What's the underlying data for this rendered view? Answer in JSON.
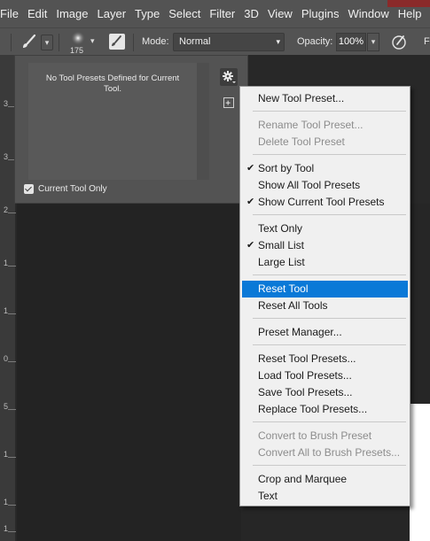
{
  "menubar": {
    "items": [
      "File",
      "Edit",
      "Image",
      "Layer",
      "Type",
      "Select",
      "Filter",
      "3D",
      "View",
      "Plugins",
      "Window",
      "Help"
    ]
  },
  "options_bar": {
    "brush_size": "175",
    "mode_label": "Mode:",
    "mode_value": "Normal",
    "opacity_label": "Opacity:",
    "opacity_value": "100%",
    "trailing_text": "Fl"
  },
  "tool_presets_panel": {
    "empty_message": "No Tool Presets Defined for Current Tool.",
    "current_tool_only_label": "Current Tool Only",
    "current_tool_only_checked": true
  },
  "ruler": {
    "labels": [
      "3",
      "3",
      "2",
      "1",
      "1",
      "0",
      "5",
      "1",
      "1",
      "1"
    ]
  },
  "flyout_menu": {
    "items": [
      {
        "label": "New Tool Preset...",
        "enabled": true,
        "checked": false
      },
      {
        "label": "Rename Tool Preset...",
        "enabled": false,
        "checked": false
      },
      {
        "label": "Delete Tool Preset",
        "enabled": false,
        "checked": false
      },
      {
        "label": "Sort by Tool",
        "enabled": true,
        "checked": true
      },
      {
        "label": "Show All Tool Presets",
        "enabled": true,
        "checked": false
      },
      {
        "label": "Show Current Tool Presets",
        "enabled": true,
        "checked": true
      },
      {
        "label": "Text Only",
        "enabled": true,
        "checked": false
      },
      {
        "label": "Small List",
        "enabled": true,
        "checked": true
      },
      {
        "label": "Large List",
        "enabled": true,
        "checked": false
      },
      {
        "label": "Reset Tool",
        "enabled": true,
        "checked": false,
        "highlighted": true
      },
      {
        "label": "Reset All Tools",
        "enabled": true,
        "checked": false
      },
      {
        "label": "Preset Manager...",
        "enabled": true,
        "checked": false
      },
      {
        "label": "Reset Tool Presets...",
        "enabled": true,
        "checked": false
      },
      {
        "label": "Load Tool Presets...",
        "enabled": true,
        "checked": false
      },
      {
        "label": "Save Tool Presets...",
        "enabled": true,
        "checked": false
      },
      {
        "label": "Replace Tool Presets...",
        "enabled": true,
        "checked": false
      },
      {
        "label": "Convert to Brush Preset",
        "enabled": false,
        "checked": false
      },
      {
        "label": "Convert All to Brush Presets...",
        "enabled": false,
        "checked": false
      },
      {
        "label": "Crop and Marquee",
        "enabled": true,
        "checked": false
      },
      {
        "label": "Text",
        "enabled": true,
        "checked": false
      }
    ],
    "check_glyph": "✔"
  },
  "colors": {
    "chrome": "#535353",
    "menu_background": "#f0f0f0",
    "menu_highlight": "#0a79d7",
    "disabled_text": "#8c8c8c"
  }
}
